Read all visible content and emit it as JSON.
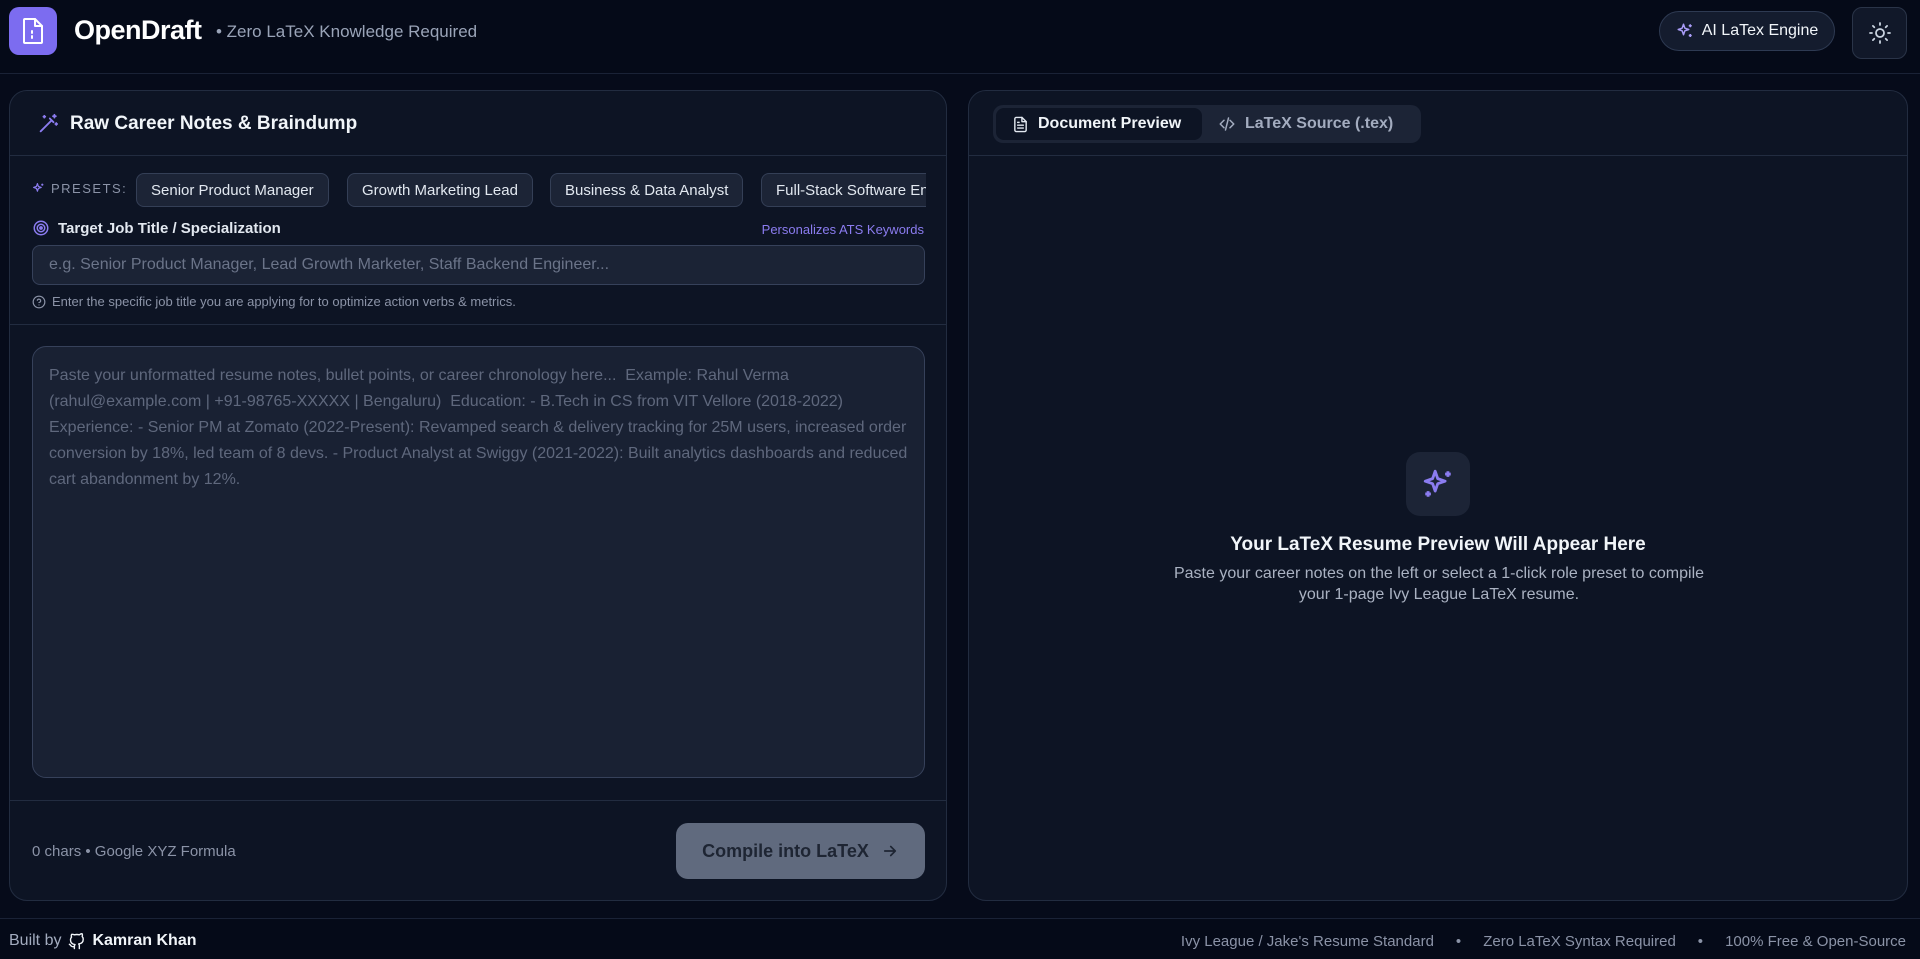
{
  "header": {
    "brand": "OpenDraft",
    "tagline": "• Zero LaTeX Knowledge Required",
    "engine_button": "AI LaTex Engine"
  },
  "left_panel": {
    "title": "Raw Career Notes & Braindump",
    "presets_label": "PRESETS:",
    "presets": [
      "Senior Product Manager",
      "Growth Marketing Lead",
      "Business & Data Analyst",
      "Full-Stack Software Engineer"
    ],
    "target_label": "Target Job Title / Specialization",
    "ats_note": "Personalizes ATS Keywords",
    "job_placeholder": "e.g. Senior Product Manager, Lead Growth Marketer, Staff Backend Engineer...",
    "hint": "Enter the specific job title you are applying for to optimize action verbs & metrics.",
    "notes_placeholder": "Paste your unformatted resume notes, bullet points, or career chronology here...  Example: Rahul Verma (rahul@example.com | +91-98765-XXXXX | Bengaluru)  Education: - B.Tech in CS from VIT Vellore (2018-2022)  Experience: - Senior PM at Zomato (2022-Present): Revamped search & delivery tracking for 25M users, increased order conversion by 18%, led team of 8 devs. - Product Analyst at Swiggy (2021-2022): Built analytics dashboards and reduced cart abandonment by 12%.",
    "char_count": "0 chars • Google XYZ Formula",
    "compile_button": "Compile into LaTeX"
  },
  "right_panel": {
    "tab_preview": "Document Preview",
    "tab_source": "LaTeX Source (.tex)",
    "empty_title": "Your LaTeX Resume Preview Will Appear Here",
    "empty_desc": "Paste your career notes on the left or select a 1-click role preset to compile your 1-page Ivy League LaTeX resume."
  },
  "footer": {
    "built_by": "Built by",
    "author": "Kamran Khan",
    "items": [
      "Ivy League / Jake's Resume Standard",
      "Zero LaTeX Syntax Required",
      "100% Free & Open-Source"
    ],
    "separator": "•"
  },
  "colors": {
    "accent": "#7c6cf0",
    "background": "#060b1a",
    "panel": "#0d1424"
  }
}
